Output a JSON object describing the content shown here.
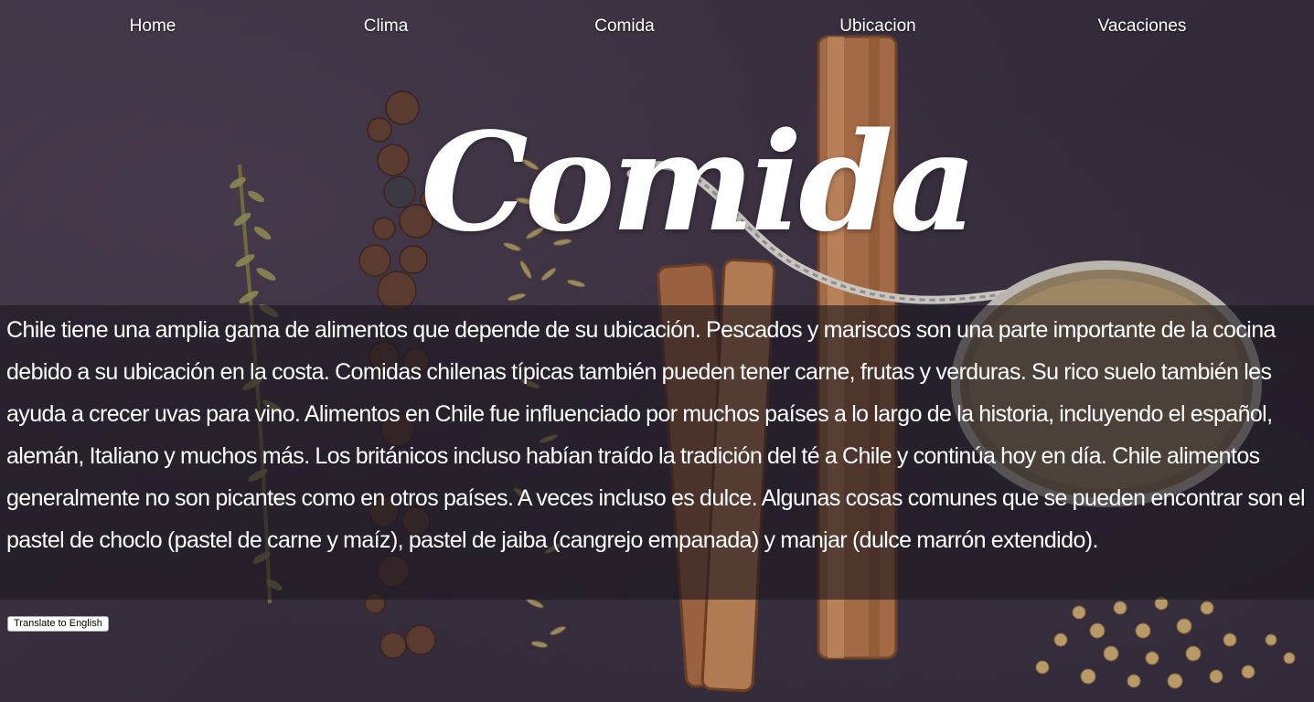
{
  "nav": {
    "items": [
      {
        "label": "Home"
      },
      {
        "label": "Clima"
      },
      {
        "label": "Comida"
      },
      {
        "label": "Ubicacion"
      },
      {
        "label": "Vacaciones"
      }
    ]
  },
  "hero": {
    "title": "Comida"
  },
  "content": {
    "paragraph": "Chile tiene una amplia gama de alimentos que depende de su ubicación. Pescados y mariscos son una parte importante de la cocina debido a su ubicación en la costa. Comidas chilenas típicas también pueden tener carne, frutas y verduras. Su rico suelo también les ayuda a crecer uvas para vino. Alimentos en Chile fue influenciado por muchos países a lo largo de la historia, incluyendo el español, alemán, Italiano y muchos más. Los británicos incluso habían traído la tradición del té a Chile y continúa hoy en día. Chile alimentos generalmente no son picantes como en otros países. A veces incluso es dulce. Algunas cosas comunes que se pueden encontrar son el pastel de choclo (pastel de carne y maíz), pastel de jaiba (cangrejo empanada) y manjar (dulce marrón extendido)."
  },
  "actions": {
    "translate_label": "Translate to English"
  },
  "colors": {
    "background": "#352c3b",
    "text": "#ffffff",
    "panel": "rgba(28,22,30,0.62)"
  }
}
